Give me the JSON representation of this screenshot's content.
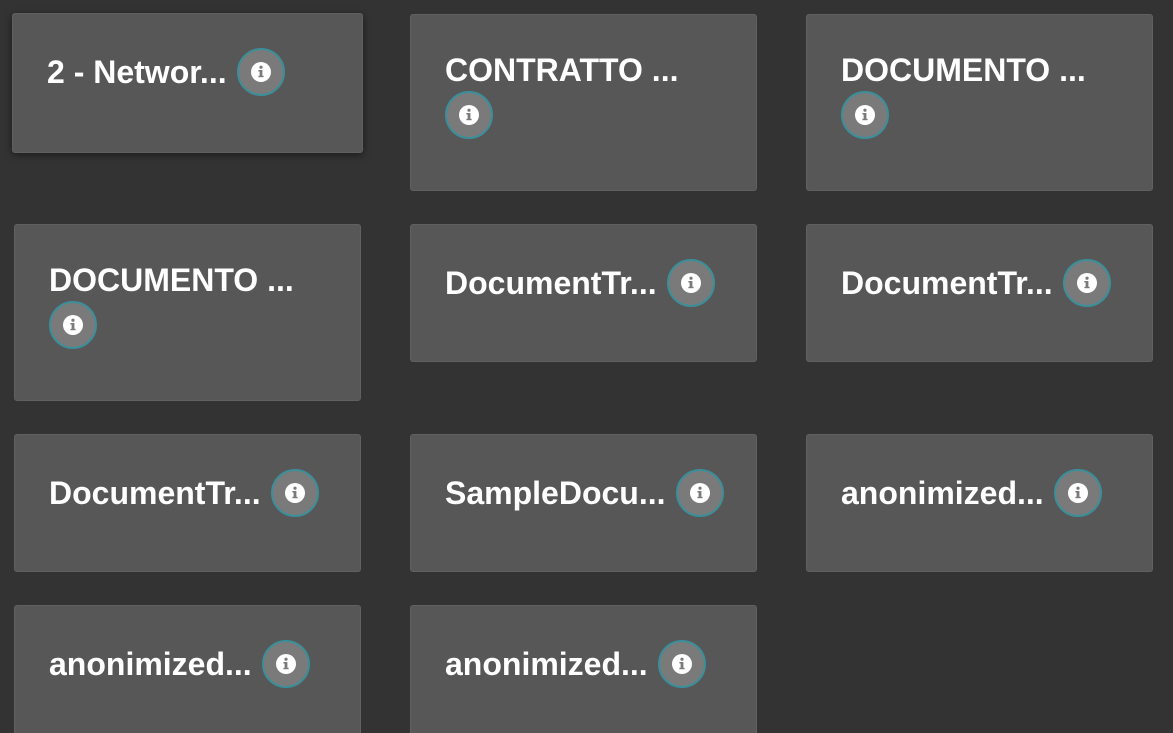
{
  "cards": [
    {
      "title": "2 - Networ...",
      "wrap": false
    },
    {
      "title": "CONTRATTO ...",
      "wrap": true
    },
    {
      "title": "DOCUMENTO ...",
      "wrap": true
    },
    {
      "title": "DOCUMENTO ...",
      "wrap": true
    },
    {
      "title": "DocumentTr...",
      "wrap": false
    },
    {
      "title": "DocumentTr...",
      "wrap": false
    },
    {
      "title": "DocumentTr...",
      "wrap": false
    },
    {
      "title": "SampleDocu...",
      "wrap": false
    },
    {
      "title": "anonimized...",
      "wrap": false
    },
    {
      "title": "anonimized...",
      "wrap": false
    },
    {
      "title": "anonimized...",
      "wrap": false
    }
  ],
  "icons": {
    "info": "info-icon"
  },
  "colors": {
    "background": "#333333",
    "card": "#575757",
    "info_ring": "#3b8f9a",
    "info_fill": "#7a7a7a"
  }
}
